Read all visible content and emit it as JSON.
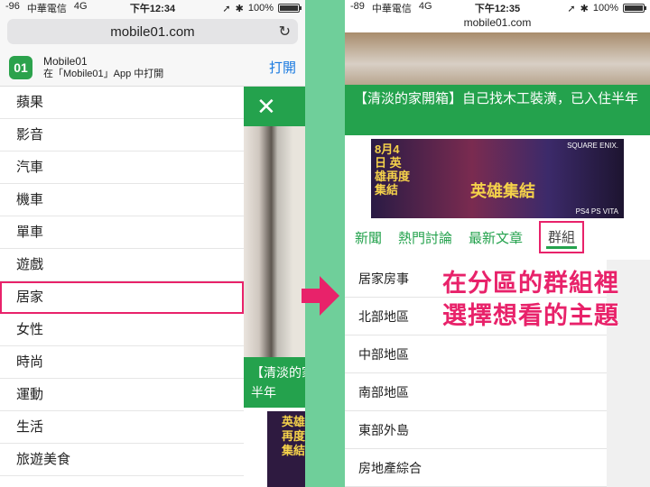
{
  "left": {
    "status": {
      "signal": "-96",
      "carrier": "中華電信",
      "network": "4G",
      "time": "下午12:34",
      "battery": "100%",
      "battery_level": 1.0
    },
    "url": "mobile01.com",
    "banner": {
      "app_name": "Mobile01",
      "subtitle": "在「Mobile01」App 中打開",
      "open": "打開"
    },
    "menu": [
      {
        "label": "蘋果",
        "selected": false
      },
      {
        "label": "影音",
        "selected": false
      },
      {
        "label": "汽車",
        "selected": false
      },
      {
        "label": "機車",
        "selected": false
      },
      {
        "label": "單車",
        "selected": false
      },
      {
        "label": "遊戲",
        "selected": false
      },
      {
        "label": "居家",
        "selected": true
      },
      {
        "label": "女性",
        "selected": false
      },
      {
        "label": "時尚",
        "selected": false
      },
      {
        "label": "運動",
        "selected": false
      },
      {
        "label": "生活",
        "selected": false
      },
      {
        "label": "旅遊美食",
        "selected": false
      }
    ],
    "drawer": {
      "title": "【清淡的家開箱】",
      "title_line2": "半年",
      "ad_text": "英雄再度集結"
    }
  },
  "right": {
    "status": {
      "signal": "-89",
      "carrier": "中華電信",
      "network": "4G",
      "time": "下午12:35",
      "battery": "100%",
      "battery_level": 1.0
    },
    "url": "mobile01.com",
    "article_title": "【清淡的家開箱】自己找木工裝潢，已入住半年",
    "ad": {
      "left": "8月4日 英雄再度集結",
      "center": "英雄集結",
      "top": "SQUARE ENIX.",
      "bottom": "PS4 PS VITA"
    },
    "tabs": [
      {
        "label": "新聞",
        "active": false
      },
      {
        "label": "熱門討論",
        "active": false
      },
      {
        "label": "最新文章",
        "active": false
      },
      {
        "label": "群組",
        "active": true
      }
    ],
    "groups": [
      "居家房事",
      "北部地區",
      "中部地區",
      "南部地區",
      "東部外島",
      "房地產綜合"
    ],
    "overlay": [
      "在分區的群組裡",
      "選擇想看的主題"
    ]
  },
  "colors": {
    "accent_green": "#24a24d",
    "highlight_pink": "#e8226a",
    "background_green": "#6fcf9a"
  }
}
